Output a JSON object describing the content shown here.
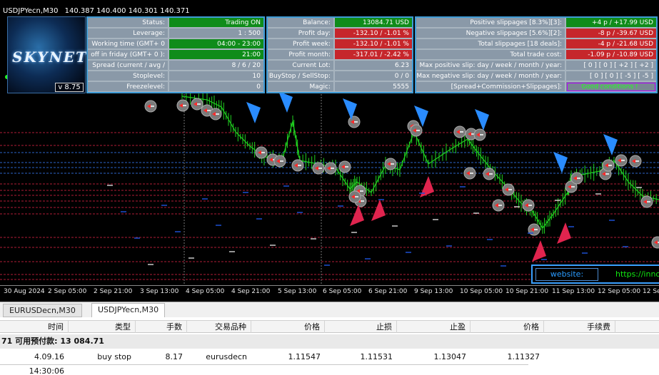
{
  "chart": {
    "symbol": "USDJPYecn,M30",
    "ohlc": "140.387 140.400 140.301 140.371"
  },
  "logo": {
    "brand": "SKYNET",
    "version": "v 8.75"
  },
  "panel1": [
    {
      "label": "Status:",
      "value": "Trading ON",
      "color": "green"
    },
    {
      "label": "Leverage:",
      "value": "1 : 500",
      "color": "gray"
    },
    {
      "label": "Working time (GMT+ 0 ):",
      "value": "04:00 - 23:00",
      "color": "green"
    },
    {
      "label": "off in friday (GMT+ 0 ):",
      "value": "21:00",
      "color": "green"
    },
    {
      "label": "Spread (current / avg / max):",
      "value": "8 / 6 / 20",
      "color": "gray"
    },
    {
      "label": "Stoplevel:",
      "value": "10",
      "color": "gray"
    },
    {
      "label": "Freezelevel:",
      "value": "0",
      "color": "gray"
    }
  ],
  "panel2": [
    {
      "label": "Balance:",
      "value": "13084.71 USD",
      "color": "green"
    },
    {
      "label": "Profit day:",
      "value": "-132.10 / -1.01 %",
      "color": "red"
    },
    {
      "label": "Profit week:",
      "value": "-132.10 / -1.01 %",
      "color": "red"
    },
    {
      "label": "Profit month:",
      "value": "-317.01 / -2.42 %",
      "color": "red"
    },
    {
      "label": "Current Lot:",
      "value": "6.23",
      "color": "gray"
    },
    {
      "label": "BuyStop / SellStop:",
      "value": "0  /  0",
      "color": "gray"
    },
    {
      "label": "Magic:",
      "value": "5555",
      "color": "gray"
    }
  ],
  "panel3": [
    {
      "label": "Positive slippages [8.3%][3]:",
      "value": "+4 p / +17.99 USD",
      "color": "green"
    },
    {
      "label": "Negative slippages [5.6%][2]:",
      "value": "-8 p / -39.67 USD",
      "color": "red"
    },
    {
      "label": "Total slippages [18 deals]:",
      "value": "-4 p / -21.68 USD",
      "color": "red"
    },
    {
      "label": "Total trade cost:",
      "value": "-1.09 p / -10.89 USD",
      "color": "red"
    },
    {
      "label": "Max positive slip: day / week / month / year:",
      "value": "[ 0 ] [ 0 ] [ +2 ] [ +2 ]",
      "color": "gray"
    },
    {
      "label": "Max negative slip: day / week / month / year:",
      "value": "[ 0 ] [ 0 ] [ -5 ] [ -5 ]",
      "color": "gray"
    },
    {
      "label": "[Spread+Commission+Slippages]:",
      "value": "Good conditions !",
      "color": "purple"
    }
  ],
  "website": {
    "label": "website:",
    "value": "https://inno"
  },
  "time_axis": [
    "30 Aug 2024",
    "2 Sep 05:00",
    "2 Sep 21:00",
    "3 Sep 13:00",
    "4 Sep 05:00",
    "4 Sep 21:00",
    "5 Sep 13:00",
    "6 Sep 05:00",
    "6 Sep 21:00",
    "9 Sep 13:00",
    "10 Sep 05:00",
    "10 Sep 21:00",
    "11 Sep 13:00",
    "12 Sep 05:00",
    "12 Se"
  ],
  "tabs": [
    {
      "label": "EURUSDecn,M30",
      "active": false
    },
    {
      "label": "USDJPYecn,M30",
      "active": true
    }
  ],
  "terminal": {
    "headers": [
      "时间",
      "类型",
      "手数",
      "交易品种",
      "价格",
      "止损",
      "止盈",
      "价格",
      "手续费"
    ],
    "balance_row": "71  可用预付款: 13 084.71",
    "order": [
      "4.09.16 14:30:06",
      "buy stop",
      "8.17",
      "eurusdecn",
      "1.11547",
      "1.11531",
      "1.13047",
      "1.11327"
    ]
  },
  "colors": {
    "candle": "#1fd11f",
    "buy_arrow": "#2a8cff",
    "sell_arrow": "#e0244e",
    "panel_border": "#3f9bd6"
  }
}
